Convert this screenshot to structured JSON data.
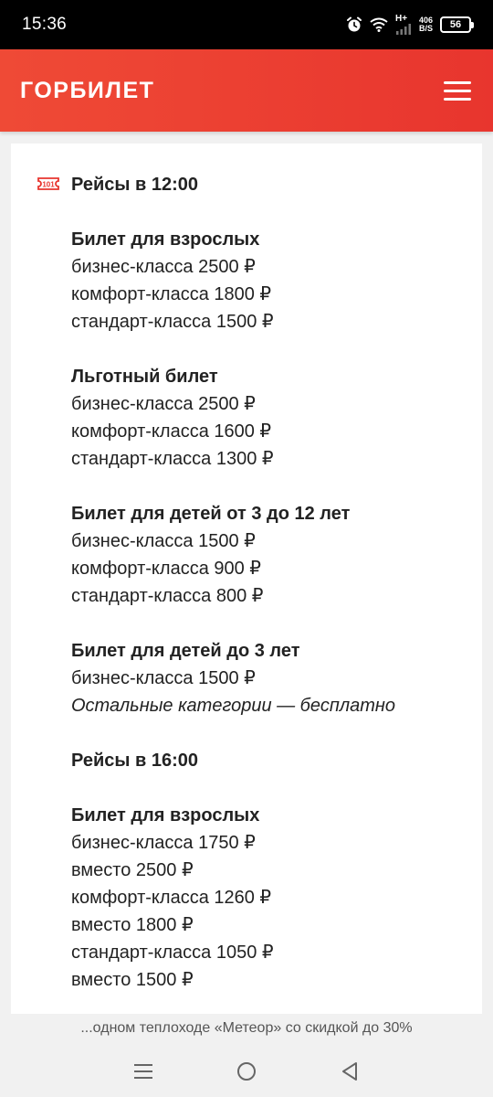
{
  "status_bar": {
    "time": "15:36",
    "network_type": "H+",
    "speed_value": "406",
    "speed_unit": "B/S",
    "battery": "56"
  },
  "header": {
    "logo_text": "ГОРБИЛЕТ",
    "brand_color": "#e8352e"
  },
  "content": {
    "lines": [
      {
        "type": "heading",
        "text": "Рейсы в 12:00"
      },
      {
        "type": "gap"
      },
      {
        "type": "heading",
        "text": "Билет для взрослых"
      },
      {
        "type": "text",
        "text": "бизнес-класса 2500 ₽"
      },
      {
        "type": "text",
        "text": "комфорт-класса 1800 ₽"
      },
      {
        "type": "text",
        "text": "стандарт-класса 1500 ₽"
      },
      {
        "type": "gap"
      },
      {
        "type": "heading",
        "text": "Льготный билет"
      },
      {
        "type": "text",
        "text": "бизнес-класса 2500 ₽"
      },
      {
        "type": "text",
        "text": "комфорт-класса 1600 ₽"
      },
      {
        "type": "text",
        "text": "стандарт-класса 1300 ₽"
      },
      {
        "type": "gap"
      },
      {
        "type": "heading",
        "text": "Билет для детей от 3 до 12 лет"
      },
      {
        "type": "text",
        "text": "бизнес-класса 1500 ₽"
      },
      {
        "type": "text",
        "text": "комфорт-класса 900 ₽"
      },
      {
        "type": "text",
        "text": "стандарт-класса 800 ₽"
      },
      {
        "type": "gap"
      },
      {
        "type": "heading",
        "text": "Билет для детей до 3 лет"
      },
      {
        "type": "text",
        "text": "бизнес-класса 1500 ₽"
      },
      {
        "type": "italic",
        "text": "Остальные категории — бесплатно"
      },
      {
        "type": "gap"
      },
      {
        "type": "heading",
        "text": "Рейсы в 16:00"
      },
      {
        "type": "gap"
      },
      {
        "type": "heading",
        "text": "Билет для взрослых"
      },
      {
        "type": "text",
        "text": "бизнес-класса 1750 ₽"
      },
      {
        "type": "text",
        "text": "вместо 2500 ₽"
      },
      {
        "type": "text",
        "text": "комфорт-класса 1260 ₽"
      },
      {
        "type": "text",
        "text": "вместо 1800 ₽"
      },
      {
        "type": "text",
        "text": "стандарт-класса 1050 ₽"
      },
      {
        "type": "text",
        "text": "вместо 1500 ₽"
      }
    ]
  },
  "footer_banner": {
    "text": "...одном теплоходе «Метеор» со скидкой до 30%"
  },
  "nav_bar": {
    "icons": [
      "menu-nav-icon",
      "home-nav-icon",
      "back-nav-icon"
    ]
  }
}
